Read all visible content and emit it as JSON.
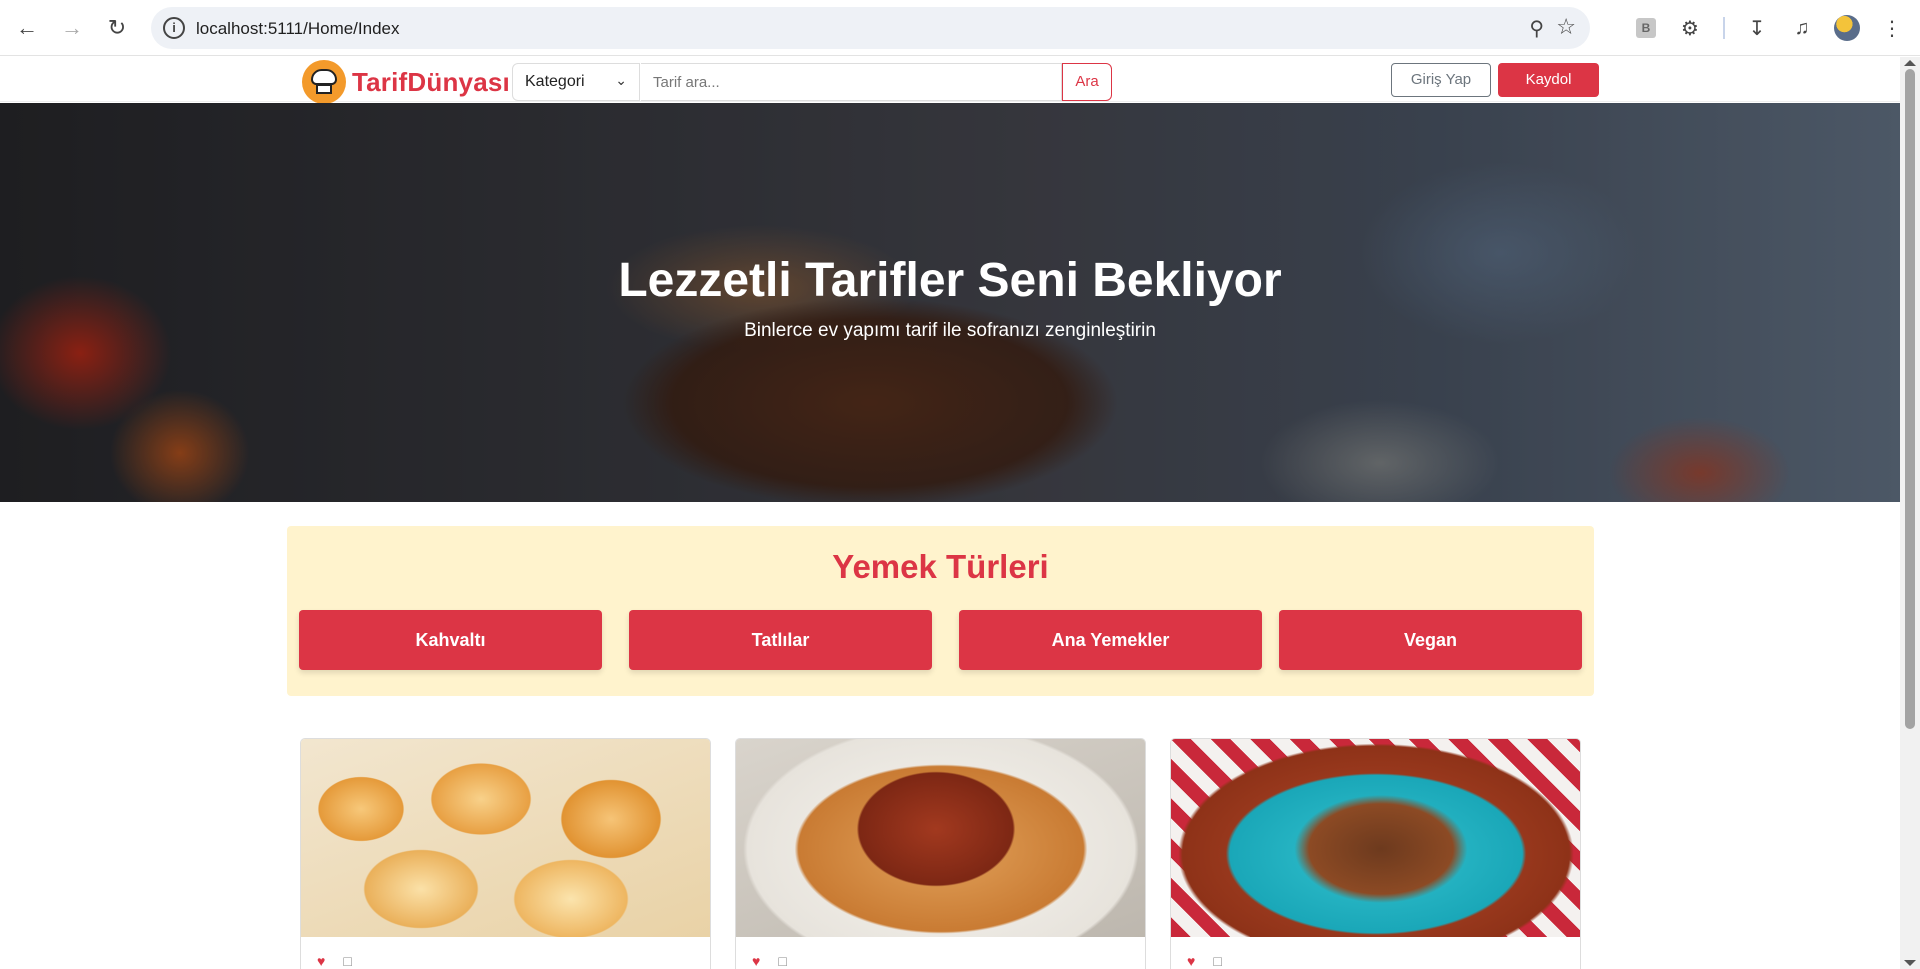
{
  "browser": {
    "url": "localhost:5111/Home/Index",
    "icons": [
      "back-icon",
      "forward-icon",
      "reload-icon",
      "site-info-icon",
      "zoom-icon",
      "bookmark-star-icon",
      "extension-b-icon",
      "extensions-puzzle-icon",
      "download-icon",
      "media-queue-icon",
      "profile-avatar",
      "menu-kebab-icon"
    ]
  },
  "navbar": {
    "brand": "TarifDünyası",
    "category_label": "Kategori",
    "search_placeholder": "Tarif ara...",
    "search_button": "Ara",
    "login_button": "Giriş Yap",
    "signup_button": "Kaydol"
  },
  "hero": {
    "title": "Lezzetli Tarifler Seni Bekliyor",
    "subtitle": "Binlerce ev yapımı tarif ile sofranızı zenginleştirin"
  },
  "categories": {
    "title": "Yemek Türleri",
    "items": [
      "Kahvaltı",
      "Tatlılar",
      "Ana Yemekler",
      "Vegan"
    ]
  },
  "cards": [
    {
      "image": "manti-pastry-photo",
      "meta": [
        "heart-icon",
        "comment-icon"
      ]
    },
    {
      "image": "chickpea-stew-photo",
      "meta": [
        "heart-icon",
        "comment-icon"
      ]
    },
    {
      "image": "eggplant-mince-photo",
      "meta": [
        "heart-icon",
        "comment-icon"
      ]
    }
  ],
  "colors": {
    "brand_red": "#dc3545",
    "logo_orange": "#f39a2b",
    "category_panel_bg": "#fff3cd"
  }
}
